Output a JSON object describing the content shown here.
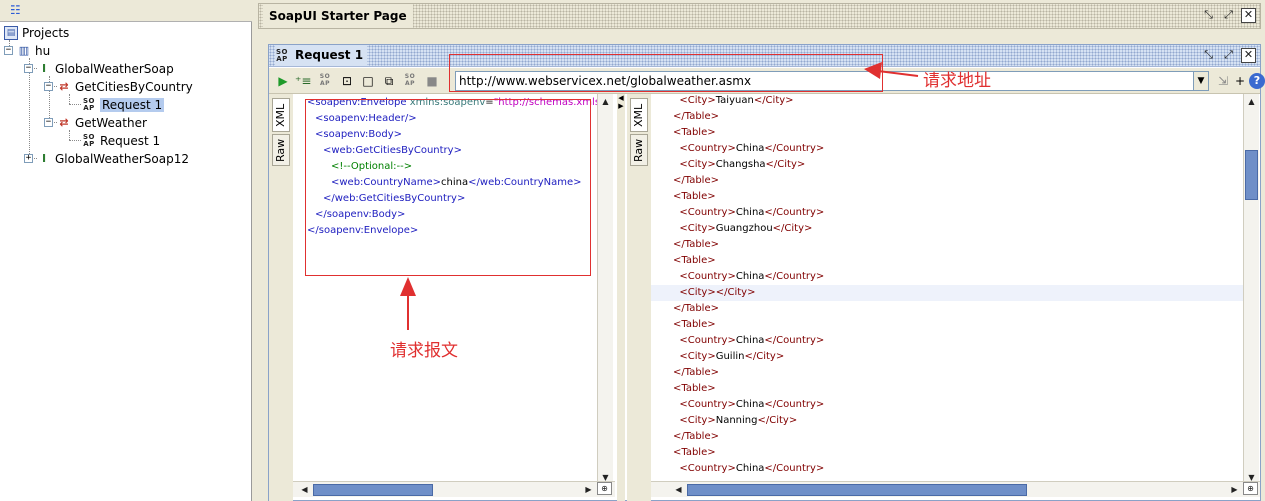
{
  "navigator": {
    "toolbar_icon": "tree-view-icon",
    "tree": [
      {
        "label": "Projects",
        "icon": "projects-icon",
        "depth": 0
      },
      {
        "label": "hu",
        "icon": "project-icon",
        "depth": 1
      },
      {
        "label": "GlobalWeatherSoap",
        "icon": "interface-icon",
        "depth": 2
      },
      {
        "label": "GetCitiesByCountry",
        "icon": "operation-icon",
        "depth": 3
      },
      {
        "label": "Request 1",
        "icon": "soap-request-icon",
        "depth": 4,
        "selected": true
      },
      {
        "label": "GetWeather",
        "icon": "operation-icon",
        "depth": 3
      },
      {
        "label": "Request 1",
        "icon": "soap-request-icon",
        "depth": 4
      },
      {
        "label": "GlobalWeatherSoap12",
        "icon": "interface-icon",
        "depth": 2
      }
    ]
  },
  "starter": {
    "title": "SoapUI Starter Page"
  },
  "request": {
    "title": "Request 1",
    "soap_icon_text": "SO\nAP",
    "url": "http://www.webservicex.net/globalweather.asmx",
    "tabs_left": [
      "XML",
      "Raw"
    ],
    "tabs_right": [
      "XML",
      "Raw"
    ],
    "request_xml": [
      {
        "indent": 0,
        "parts": [
          [
            "tagb",
            "<soapenv:Envelope "
          ],
          [
            "attr",
            "xmlns:soapenv"
          ],
          [
            "txt",
            "="
          ],
          [
            "aval",
            "\"http://schemas.xmlsoa"
          ]
        ]
      },
      {
        "indent": 1,
        "parts": [
          [
            "tagb",
            "<soapenv:Header/>"
          ]
        ]
      },
      {
        "indent": 1,
        "parts": [
          [
            "tagb",
            "<soapenv:Body>"
          ]
        ]
      },
      {
        "indent": 2,
        "parts": [
          [
            "tagb",
            "<web:GetCitiesByCountry>"
          ]
        ]
      },
      {
        "indent": 3,
        "parts": [
          [
            "cmt",
            "<!--Optional:-->"
          ]
        ]
      },
      {
        "indent": 3,
        "parts": [
          [
            "tagb",
            "<web:CountryName>"
          ],
          [
            "txt",
            "china"
          ],
          [
            "tagb",
            "</web:CountryName>"
          ]
        ]
      },
      {
        "indent": 2,
        "parts": [
          [
            "tagb",
            "</web:GetCitiesByCountry>"
          ]
        ]
      },
      {
        "indent": 1,
        "parts": [
          [
            "tagb",
            "</soapenv:Body>"
          ]
        ]
      },
      {
        "indent": 0,
        "parts": [
          [
            "tagb",
            "</soapenv:Envelope>"
          ]
        ]
      }
    ],
    "response_xml": [
      "  <City>Taiyuan</City>",
      "</Table>",
      "<Table>",
      "  <Country>China</Country>",
      "  <City>Changsha</City>",
      "</Table>",
      "<Table>",
      "  <Country>China</Country>",
      "  <City>Guangzhou</City>",
      "</Table>",
      "<Table>",
      "  <Country>China</Country>",
      "  <City></City>",
      "</Table>",
      "<Table>",
      "  <Country>China</Country>",
      "  <City>Guilin</City>",
      "</Table>",
      "<Table>",
      "  <Country>China</Country>",
      "  <City>Nanning</City>",
      "</Table>",
      "<Table>",
      "  <Country>China</Country>"
    ],
    "highlight_line": 12
  },
  "annotations": {
    "url_note": "请求地址",
    "body_note": "请求报文"
  },
  "colors": {
    "annotation": "#e03030",
    "selection": "#b4cbee",
    "scroll_thumb": "#6f8fc8"
  }
}
